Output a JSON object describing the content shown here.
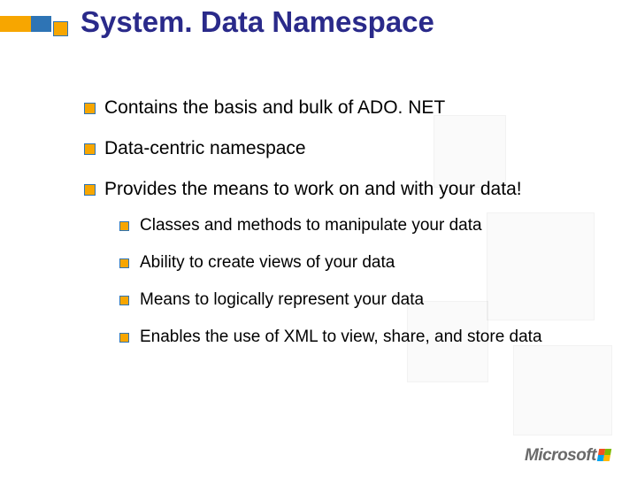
{
  "title": "System. Data Namespace",
  "bullets": [
    {
      "text": "Contains the basis and bulk of ADO. NET"
    },
    {
      "text": "Data-centric namespace"
    },
    {
      "text": "Provides the means to work on and with your data!",
      "children": [
        "Classes and methods to manipulate your data",
        "Ability to create views of your data",
        "Means to logically represent your data",
        "Enables the use of XML to view, share, and store data"
      ]
    }
  ],
  "logo": {
    "text": "Microsoft"
  }
}
